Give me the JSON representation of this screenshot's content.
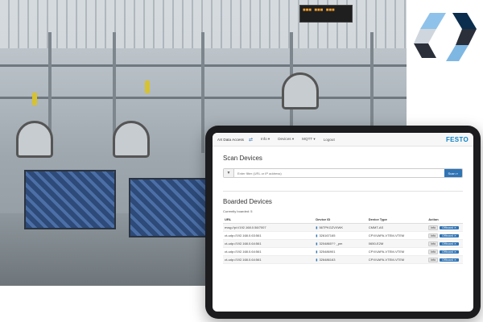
{
  "photo": {
    "display_text": "■■■ ■■■ ■■■"
  },
  "logo": {
    "colors": [
      "#7fb7e3",
      "#2a2f3a",
      "#cfd6dd",
      "#0b2e4f"
    ]
  },
  "app": {
    "nav": {
      "title": "AX Data Access",
      "icon": "exchange-arrows-icon",
      "menus": [
        "Info",
        "Devices",
        "MQTT",
        "Logout"
      ],
      "brand": "FESTO"
    },
    "scan": {
      "heading": "Scan Devices",
      "filter_icon": "filter-icon",
      "placeholder": "Enter filter (URL or IP address)",
      "button": "Scan"
    },
    "boarded": {
      "heading": "Boarded Devices",
      "count_text": "Currently boarded: 5",
      "columns": [
        "URL",
        "Device ID",
        "Device Type",
        "Action"
      ],
      "rows": [
        {
          "url": "evsg://pi://192.168.0.58/7007",
          "device_id": "56TPKGZVXWK",
          "device_type": "CMMT-AS",
          "info": "info",
          "offboard": "Offboard"
        },
        {
          "url": "ct-udp://192.168.0.63:561",
          "device_id": "326167165",
          "device_type": "CPX/VAPA-VTEM-VTEM",
          "info": "info",
          "offboard": "Offboard"
        },
        {
          "url": "ct-udp://192.168.0.64:561",
          "device_id": "3204860?? _pm",
          "device_type": "0650-E2M",
          "info": "info",
          "offboard": "Offboard"
        },
        {
          "url": "ct-udp://192.168.0.64:561",
          "device_id": "325486901",
          "device_type": "CPX/VAPA-VTEM-VTEM",
          "info": "info",
          "offboard": "Offboard"
        },
        {
          "url": "ct-udp://192.168.0.64:561",
          "device_id": "326486163",
          "device_type": "CPX/VAPA-VTEM-VTEM",
          "info": "info",
          "offboard": "Offboard"
        }
      ]
    }
  }
}
